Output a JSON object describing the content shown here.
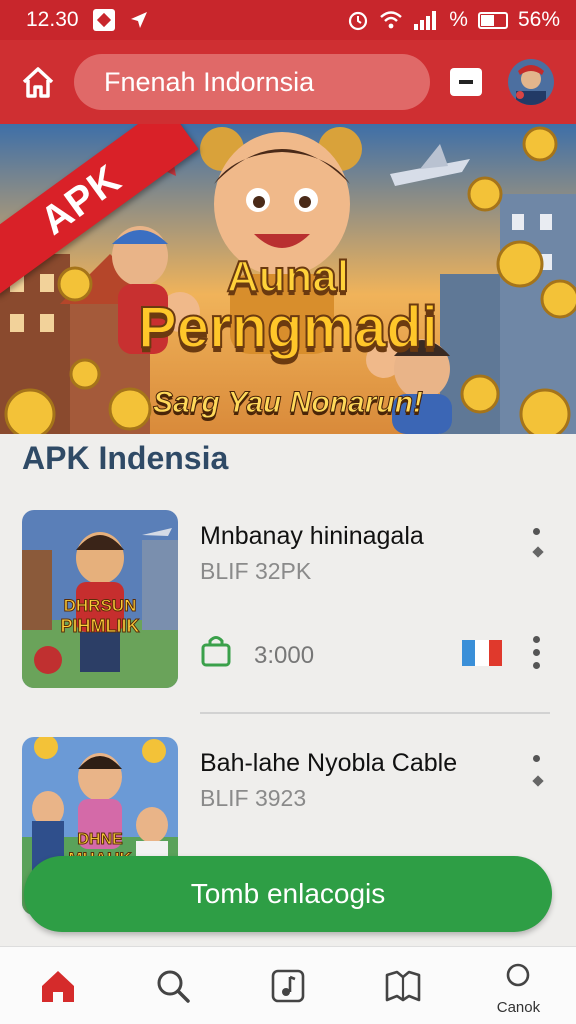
{
  "status_bar": {
    "time": "12.30",
    "battery": "56%",
    "battery_level": 0.56,
    "icons": [
      "square-icon",
      "location-arrow-icon",
      "alarm-icon",
      "wifi-icon",
      "signal-icon",
      "battery-icon"
    ]
  },
  "header": {
    "search_text": "Fnenah Indornsia",
    "home_icon": "home-icon",
    "colors": {
      "bar": "#cf2f32",
      "pill": "#e06968"
    }
  },
  "banner": {
    "ribbon": "APK",
    "title_line1": "Aunal",
    "title_line2": "Perngmadi",
    "subtitle": "Sarg Yau Nonarun!"
  },
  "section": {
    "title": "APK Indensia"
  },
  "apps": [
    {
      "name": "Mnbanay hininagala",
      "meta": "BLIF 32PK",
      "thumb_text_1": "DHRSUN",
      "thumb_text_2": "PIHMLIIK",
      "price": "3:000",
      "flag_colors": [
        "#3a8fd8",
        "#ffffff",
        "#e0392c"
      ]
    },
    {
      "name": "Bah-lahe Nyobla Cable",
      "meta": "BLIF 3923",
      "thumb_text_1": "DHNE",
      "thumb_text_2": "MHAUK"
    }
  ],
  "cta": {
    "label": "Tomb enlacogis",
    "color": "#2e9e45"
  },
  "bottom_nav": [
    {
      "icon": "home-icon",
      "label": ""
    },
    {
      "icon": "search-icon",
      "label": ""
    },
    {
      "icon": "music-note-icon",
      "label": ""
    },
    {
      "icon": "book-icon",
      "label": ""
    },
    {
      "icon": "circle-icon",
      "label": "Canok"
    }
  ]
}
